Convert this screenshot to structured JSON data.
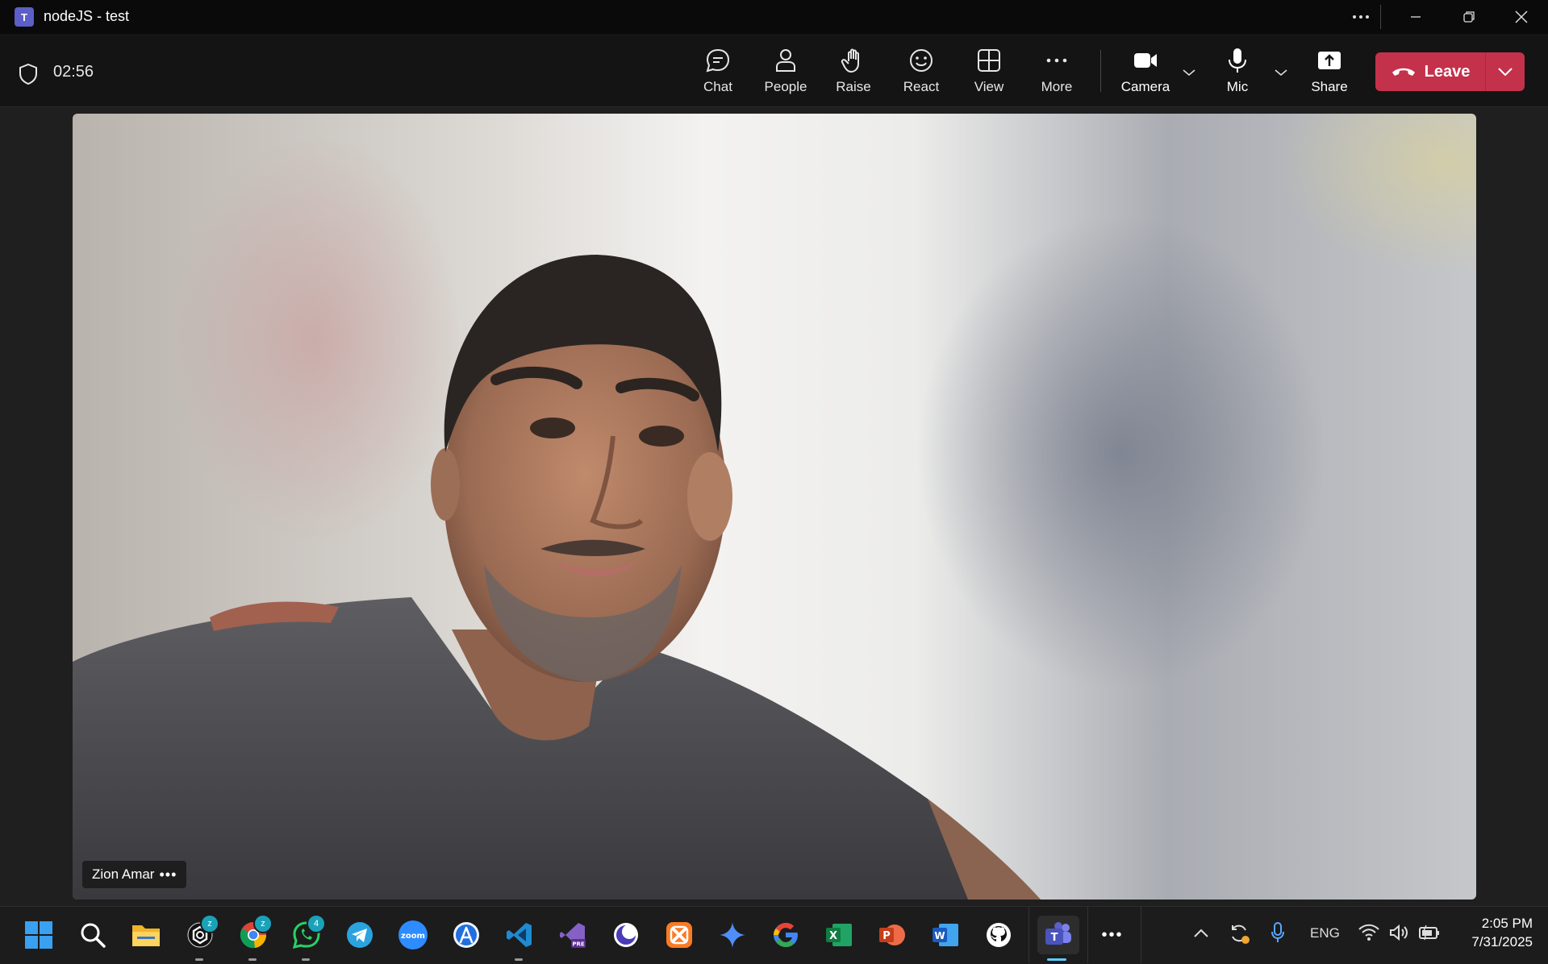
{
  "window": {
    "title": "nodeJS - test",
    "app_icon": "teams-logo",
    "logo_letter": "T"
  },
  "toolbar": {
    "timer": "02:56",
    "buttons": {
      "chat": "Chat",
      "people": "People",
      "raise": "Raise",
      "react": "React",
      "view": "View",
      "more": "More",
      "camera": "Camera",
      "mic": "Mic",
      "share": "Share"
    },
    "leave_label": "Leave",
    "leave_color": "#c4314b"
  },
  "video": {
    "participant_name": "Zion Amar",
    "more_label": "•••"
  },
  "taskbar": {
    "apps": [
      {
        "name": "start",
        "icon": "windows-logo-icon"
      },
      {
        "name": "search",
        "icon": "search-icon"
      },
      {
        "name": "file-explorer",
        "icon": "folder-icon"
      },
      {
        "name": "chatgpt",
        "icon": "chatgpt-icon",
        "badge": "z"
      },
      {
        "name": "chrome",
        "icon": "chrome-icon",
        "badge": "z"
      },
      {
        "name": "whatsapp",
        "icon": "whatsapp-icon",
        "badge": "4"
      },
      {
        "name": "telegram",
        "icon": "telegram-icon"
      },
      {
        "name": "zoom",
        "icon": "zoom-icon",
        "label": "zoom"
      },
      {
        "name": "app-store",
        "icon": "app-store-icon"
      },
      {
        "name": "vscode",
        "icon": "vscode-icon"
      },
      {
        "name": "visual-studio-preview",
        "icon": "visual-studio-icon",
        "label": "PRE"
      },
      {
        "name": "arc",
        "icon": "arc-icon"
      },
      {
        "name": "xampp",
        "icon": "xampp-icon"
      },
      {
        "name": "gemini",
        "icon": "gemini-icon"
      },
      {
        "name": "google",
        "icon": "google-icon"
      },
      {
        "name": "excel",
        "icon": "excel-icon",
        "label": "X"
      },
      {
        "name": "powerpoint",
        "icon": "powerpoint-icon",
        "label": "P"
      },
      {
        "name": "word",
        "icon": "word-icon",
        "label": "W"
      },
      {
        "name": "github",
        "icon": "github-icon"
      },
      {
        "name": "teams",
        "icon": "teams-icon",
        "label": "T"
      }
    ],
    "overflow": "•••",
    "tray": {
      "language": "ENG"
    },
    "clock": {
      "time": "2:05 PM",
      "date": "7/31/2025"
    }
  }
}
